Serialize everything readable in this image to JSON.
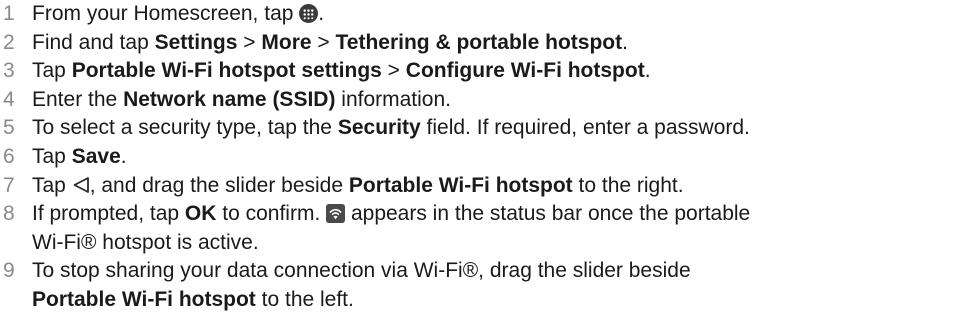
{
  "steps": [
    {
      "num": "1",
      "a": "From your Homescreen, tap ",
      "icon": "apps-grid-icon",
      "b": "."
    },
    {
      "num": "2",
      "a": "Find and tap ",
      "k1": "Settings",
      "s1": " > ",
      "k2": "More",
      "s2": " > ",
      "k3": "Tethering & portable hotspot",
      "b": "."
    },
    {
      "num": "3",
      "a": "Tap ",
      "k1": "Portable Wi-Fi hotspot settings",
      "s1": " > ",
      "k2": "Configure Wi-Fi hotspot",
      "b": "."
    },
    {
      "num": "4",
      "a": "Enter the ",
      "k1": "Network name (SSID)",
      "b": " information."
    },
    {
      "num": "5",
      "a": "To select a security type, tap the ",
      "k1": "Security",
      "b": " field. If required, enter a password."
    },
    {
      "num": "6",
      "a": "Tap ",
      "k1": "Save",
      "b": "."
    },
    {
      "num": "7",
      "a": "Tap ",
      "icon": "back-triangle-icon",
      "b": ", and drag the slider beside ",
      "k1": "Portable Wi-Fi hotspot",
      "c": " to the right."
    },
    {
      "num": "8",
      "a": "If prompted, tap ",
      "k1": "OK",
      "b": " to confirm. ",
      "icon": "wifi-hotspot-icon",
      "c": " appears in the status bar once the portable",
      "cont": "Wi-Fi® hotspot is active."
    },
    {
      "num": "9",
      "a": "To stop sharing your data connection via Wi-Fi®, drag the slider beside",
      "k1": "Portable Wi-Fi hotspot",
      "b": " to the left."
    }
  ]
}
